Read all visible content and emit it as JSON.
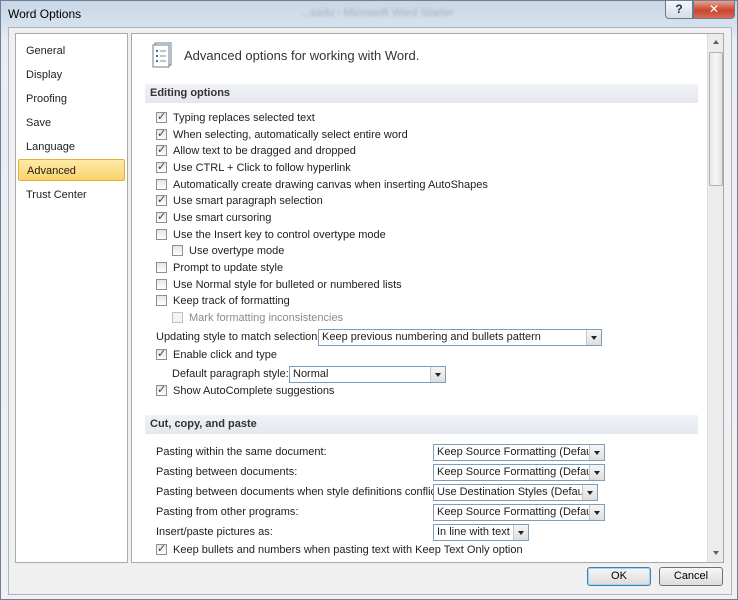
{
  "window": {
    "title": "Word Options",
    "background_title": "...sadu - Microsoft Word Starter",
    "help_label": "?",
    "close_label": "✕"
  },
  "sidebar": {
    "items": [
      {
        "label": "General"
      },
      {
        "label": "Display"
      },
      {
        "label": "Proofing"
      },
      {
        "label": "Save"
      },
      {
        "label": "Language"
      },
      {
        "label": "Advanced",
        "selected": true
      },
      {
        "label": "Trust Center"
      }
    ]
  },
  "main": {
    "header": "Advanced options for working with Word.",
    "editing": {
      "title": "Editing options",
      "options": [
        {
          "label": "Typing replaces selected text",
          "checked": true
        },
        {
          "label": "When selecting, automatically select entire word",
          "checked": true
        },
        {
          "label": "Allow text to be dragged and dropped",
          "checked": true
        },
        {
          "label": "Use CTRL + Click to follow hyperlink",
          "checked": true
        },
        {
          "label": "Automatically create drawing canvas when inserting AutoShapes",
          "checked": false
        },
        {
          "label": "Use smart paragraph selection",
          "checked": true
        },
        {
          "label": "Use smart cursoring",
          "checked": true
        },
        {
          "label": "Use the Insert key to control overtype mode",
          "checked": false
        },
        {
          "label": "Use overtype mode",
          "checked": false
        },
        {
          "label": "Prompt to update style",
          "checked": false
        },
        {
          "label": "Use Normal style for bulleted or numbered lists",
          "checked": false
        },
        {
          "label": "Keep track of formatting",
          "checked": false
        },
        {
          "label": "Mark formatting inconsistencies",
          "checked": false,
          "disabled": true
        }
      ],
      "updating_style_label": "Updating style to match selection:",
      "updating_style_value": "Keep previous numbering and bullets pattern",
      "click_and_type": {
        "label": "Enable click and type",
        "checked": true
      },
      "default_paragraph_label": "Default paragraph style:",
      "default_paragraph_value": "Normal",
      "autocomplete": {
        "label": "Show AutoComplete suggestions",
        "checked": true
      }
    },
    "paste": {
      "title": "Cut, copy, and paste",
      "rows": [
        {
          "label": "Pasting within the same document:",
          "value": "Keep Source Formatting (Default)"
        },
        {
          "label": "Pasting between documents:",
          "value": "Keep Source Formatting (Default)"
        },
        {
          "label": "Pasting between documents when style definitions conflict:",
          "value": "Use Destination Styles (Default)"
        },
        {
          "label": "Pasting from other programs:",
          "value": "Keep Source Formatting (Default)"
        },
        {
          "label": "Insert/paste pictures as:",
          "value": "In line with text"
        }
      ],
      "keep_bullets": {
        "label": "Keep bullets and numbers when pasting text with Keep Text Only option",
        "checked": true
      }
    }
  },
  "footer": {
    "ok_label": "OK",
    "cancel_label": "Cancel"
  }
}
